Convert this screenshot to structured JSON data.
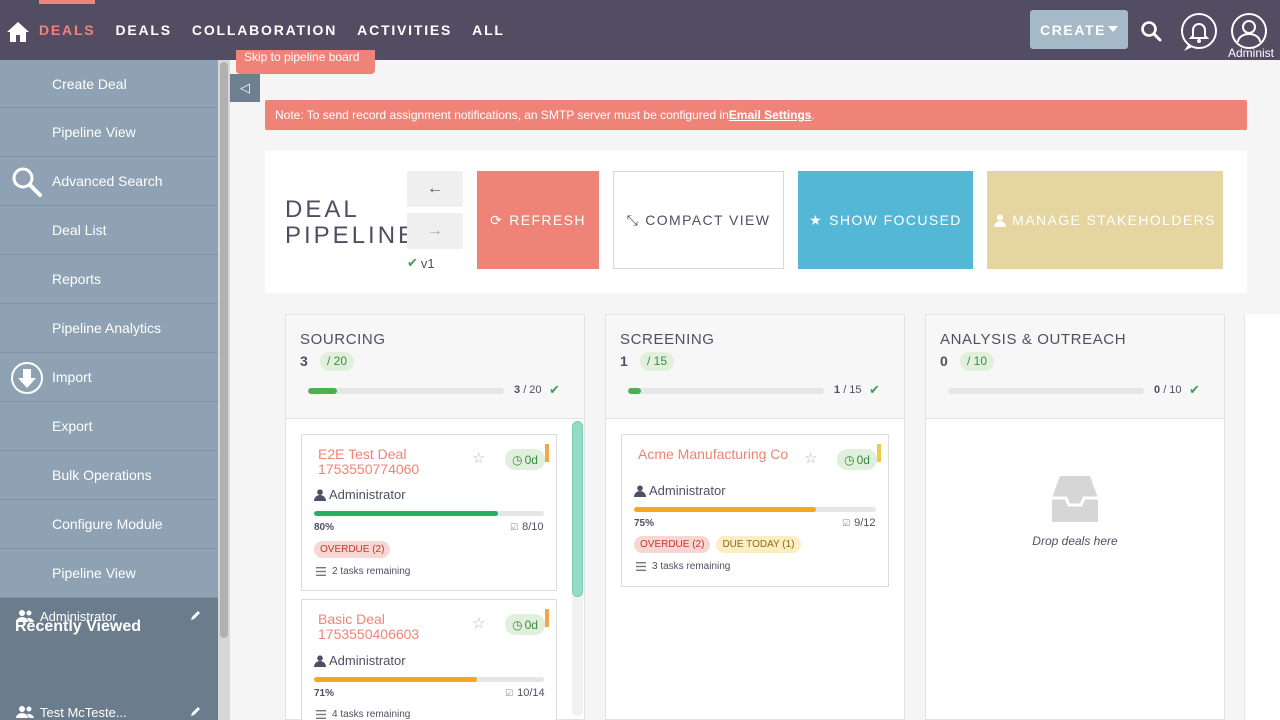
{
  "nav": {
    "items": [
      {
        "label": "DEALS",
        "active": true
      },
      {
        "label": "DEALS",
        "active": false
      },
      {
        "label": "COLLABORATION",
        "active": false
      },
      {
        "label": "ACTIVITIES",
        "active": false
      },
      {
        "label": "ALL",
        "active": false
      }
    ],
    "create_label": "CREATE",
    "user_label": "Administ",
    "icons": {
      "home": "home-icon",
      "search": "search-icon",
      "notifications": "bell-icon",
      "user": "user-icon"
    }
  },
  "sidebar": {
    "items": [
      {
        "label": "Create Deal"
      },
      {
        "label": "Pipeline View"
      },
      {
        "label": "Advanced Search",
        "icon": "search-icon"
      },
      {
        "label": "Deal List"
      },
      {
        "label": "Reports"
      },
      {
        "label": "Pipeline Analytics"
      },
      {
        "label": "Import",
        "icon": "download-icon"
      },
      {
        "label": "Export"
      },
      {
        "label": "Bulk Operations"
      },
      {
        "label": "Configure Module"
      },
      {
        "label": "Pipeline View"
      }
    ],
    "recent_title": "Recently Viewed",
    "recent": [
      {
        "label": "Administrator"
      },
      {
        "label": "Test McTeste..."
      }
    ]
  },
  "skip_link": "Skip to pipeline board",
  "collapse_glyph": "◁",
  "note": {
    "text": "Note: To send record assignment notifications, an SMTP server must be configured in ",
    "link": "Email Settings",
    "suffix": "."
  },
  "header": {
    "title_line1": "DEAL",
    "title_line2": "PIPELINE",
    "prev_glyph": "←",
    "next_glyph": "→",
    "version": "v1",
    "buttons": {
      "refresh": "REFRESH",
      "compact": "COMPACT VIEW",
      "focused": "SHOW FOCUSED",
      "stakeholders": "MANAGE STAKEHOLDERS"
    }
  },
  "columns": [
    {
      "title": "SOURCING",
      "count": "3",
      "limit": "/ 20",
      "frac_num": "3",
      "frac_den": "/ 20",
      "progress": 0.15
    },
    {
      "title": "SCREENING",
      "count": "1",
      "limit": "/ 15",
      "frac_num": "1",
      "frac_den": "/ 15",
      "progress": 0.0667
    },
    {
      "title": "ANALYSIS & OUTREACH",
      "count": "0",
      "limit": "/ 10",
      "frac_num": "0",
      "frac_den": "/ 10",
      "progress": 0.0
    }
  ],
  "cards": [
    {
      "title_l1": "E2E Test Deal",
      "title_l2": "1753550774060",
      "days": "0d",
      "owner": "Administrator",
      "pct": "80%",
      "progress": 0.8,
      "tasks": "8/10",
      "tags": [
        "OVERDUE (2)"
      ],
      "remaining": "2 tasks remaining",
      "bar_color": "#27ae60",
      "flag_color": "#f5a54a"
    },
    {
      "title_l1": "Basic Deal",
      "title_l2": "1753550406603",
      "days": "0d",
      "owner": "Administrator",
      "pct": "71%",
      "progress": 0.71,
      "tasks": "10/14",
      "tags": [],
      "remaining": "4 tasks remaining",
      "bar_color": "#f5a623",
      "flag_color": "#f5a54a"
    },
    {
      "title_l1": "Acme Manufacturing Co",
      "title_l2": "",
      "days": "0d",
      "owner": "Administrator",
      "pct": "75%",
      "progress": 0.75,
      "tasks": "9/12",
      "tags": [
        "OVERDUE (2)",
        "DUE TODAY (1)"
      ],
      "remaining": "3 tasks remaining",
      "bar_color": "#f5a623",
      "flag_color": "#f2c94c"
    }
  ],
  "empty_text": "Drop deals here",
  "colors": {
    "accent": "#f08377",
    "nav_bg": "#534d64",
    "sidebar_bg": "#8ea2b4",
    "focus_blue": "#54b7d6",
    "stake_tan": "#e5d5a0"
  }
}
